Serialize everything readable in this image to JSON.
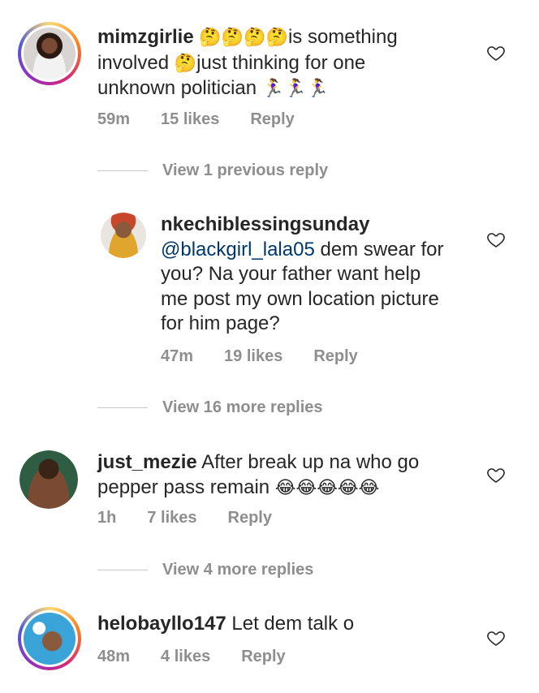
{
  "comments": [
    {
      "username": "mimzgirlie",
      "text_line1_emoji": "🤔🤔🤔🤔",
      "text_line1": "is something",
      "text_line2_pre": "involved ",
      "text_line2_emoji": "🤔",
      "text_line2_post": "just thinking for one",
      "text_line3": "unknown politician ",
      "text_line3_emoji": "🏃‍♀️🏃‍♀️🏃‍♀️",
      "time": "59m",
      "likes": "15 likes",
      "reply": "Reply"
    },
    {
      "username": "nkechiblessingsunday",
      "mention": "@blackgirl_lala05",
      "text_line1": " dem swear for",
      "text_line2": "you? Na your father want help",
      "text_line3": "me post my own location picture",
      "text_line4": "for him page?",
      "time": "47m",
      "likes": "19 likes",
      "reply": "Reply"
    },
    {
      "username": "just_mezie",
      "text_line1": " After break up na who go",
      "text_line2": "pepper pass remain ",
      "text_line2_emoji": "😂😂😂😂😂",
      "time": "1h",
      "likes": "7 likes",
      "reply": "Reply"
    },
    {
      "username": "helobayllo147",
      "text_line1": " Let dem talk o",
      "time": "48m",
      "likes": "4 likes",
      "reply": "Reply"
    }
  ],
  "view_replies": [
    "View 1 previous reply",
    "View 16 more replies",
    "View 4 more replies"
  ],
  "icons": {
    "like": "heart-outline-icon"
  },
  "colors": {
    "text": "#262626",
    "secondary": "#8e8e8e",
    "mention": "#00376b"
  }
}
